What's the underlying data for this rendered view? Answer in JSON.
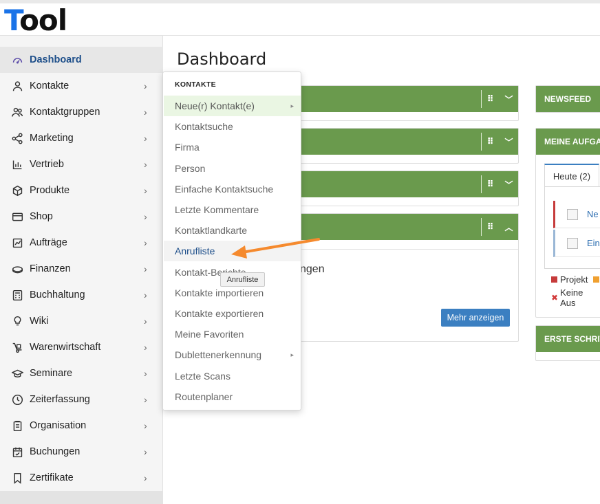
{
  "app": {
    "logo_accent": "T",
    "logo_rest": "ool"
  },
  "sidebar": {
    "items": [
      {
        "label": "Dashboard",
        "icon": "dashboard-gauge-icon",
        "active": true
      },
      {
        "label": "Kontakte",
        "icon": "person-icon"
      },
      {
        "label": "Kontaktgruppen",
        "icon": "people-group-icon"
      },
      {
        "label": "Marketing",
        "icon": "share-network-icon"
      },
      {
        "label": "Vertrieb",
        "icon": "bar-chart-icon"
      },
      {
        "label": "Produkte",
        "icon": "box-cube-icon"
      },
      {
        "label": "Shop",
        "icon": "credit-card-icon"
      },
      {
        "label": "Aufträge",
        "icon": "chart-document-icon"
      },
      {
        "label": "Finanzen",
        "icon": "coins-icon"
      },
      {
        "label": "Buchhaltung",
        "icon": "calculator-icon"
      },
      {
        "label": "Wiki",
        "icon": "lightbulb-icon"
      },
      {
        "label": "Warenwirtschaft",
        "icon": "hand-truck-icon"
      },
      {
        "label": "Seminare",
        "icon": "graduation-cap-icon"
      },
      {
        "label": "Zeiterfassung",
        "icon": "clock-icon"
      },
      {
        "label": "Organisation",
        "icon": "clipboard-icon"
      },
      {
        "label": "Buchungen",
        "icon": "calendar-check-icon"
      },
      {
        "label": "Zertifikate",
        "icon": "bookmark-icon"
      }
    ],
    "chevron": "›"
  },
  "main": {
    "title": "Dashboard",
    "more_button": "Mehr anzeigen",
    "partial_text": "ngen"
  },
  "right": {
    "newsfeed": "NEWSFEED",
    "tasks_title": "MEINE AUFGA",
    "tab_today": "Heute (2)",
    "task_links": [
      "Ne",
      "Ein"
    ],
    "legend_project": "Projekt",
    "legend_none": "Keine Aus",
    "first_steps": "ERSTE SCHRIT"
  },
  "dropdown": {
    "header": "KONTAKTE",
    "items": [
      {
        "label": "Neue(r) Kontakt(e)",
        "submenu": true,
        "state": "hover"
      },
      {
        "label": "Kontaktsuche"
      },
      {
        "label": "Firma"
      },
      {
        "label": "Person"
      },
      {
        "label": "Einfache Kontaktsuche"
      },
      {
        "label": "Letzte Kommentare"
      },
      {
        "label": "Kontaktlandkarte"
      },
      {
        "label": "Anrufliste",
        "state": "current"
      },
      {
        "label": "Kontakt-Berichte"
      },
      {
        "label": "Kontakte importieren"
      },
      {
        "label": "Kontakte exportieren"
      },
      {
        "label": "Meine Favoriten"
      },
      {
        "label": "Dublettenerkennung",
        "submenu": true
      },
      {
        "label": "Letzte Scans"
      },
      {
        "label": "Routenplaner"
      }
    ]
  },
  "tooltip": "Anrufliste",
  "colors": {
    "panel_green": "#6a9a4d",
    "accent_blue": "#3b7fc1",
    "arrow_orange": "#f58a2e"
  }
}
